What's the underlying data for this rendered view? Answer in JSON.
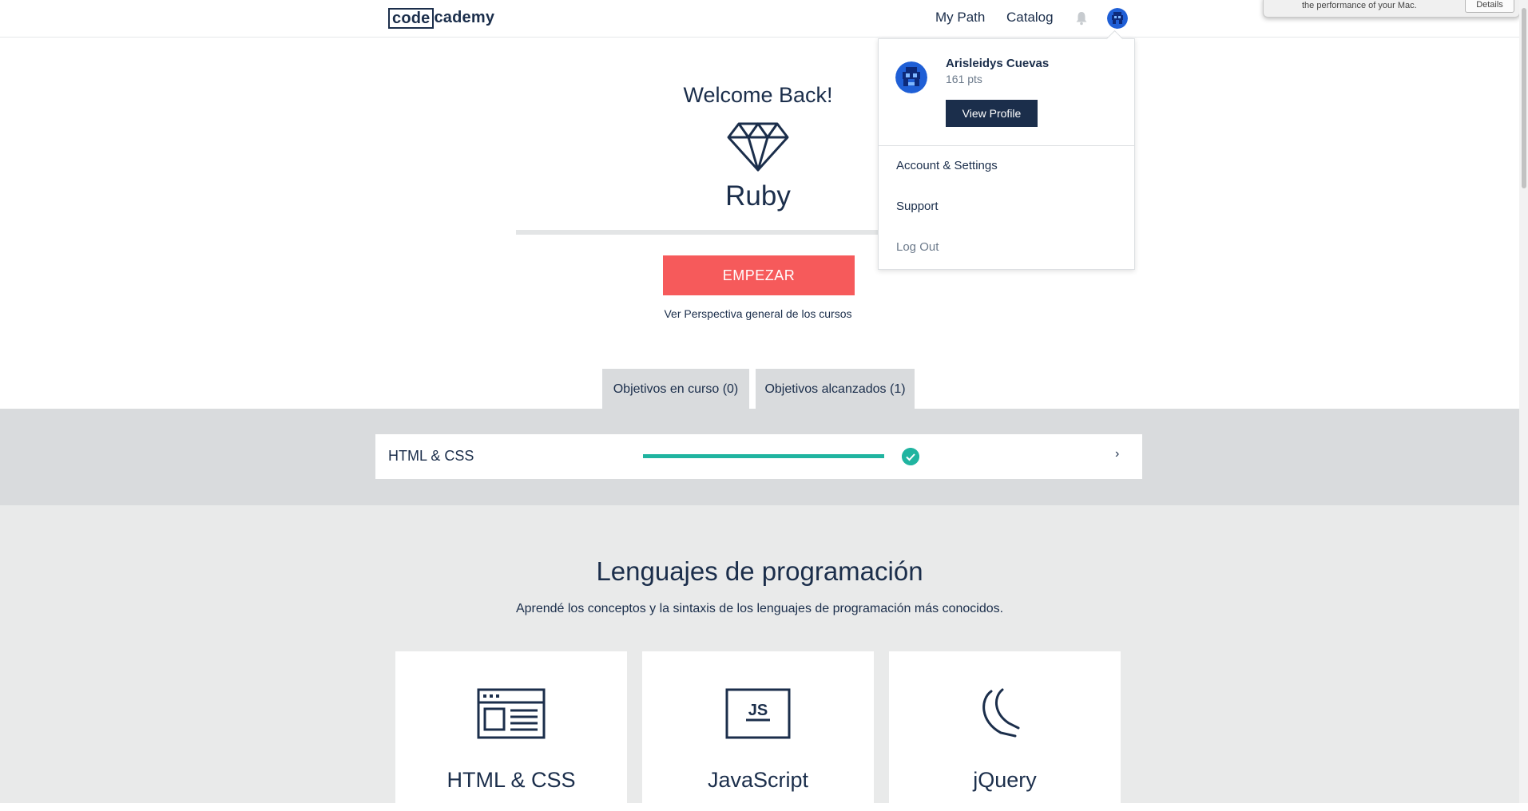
{
  "header": {
    "logo_left": "code",
    "logo_right": "cademy",
    "nav": [
      "My Path",
      "Catalog"
    ],
    "icons": [
      "bell-icon",
      "avatar-icon"
    ]
  },
  "mac_notification": {
    "text": "the performance of your Mac.",
    "button": "Details"
  },
  "hero": {
    "greeting": "Welcome Back!",
    "icon": "diamond-icon",
    "language": "Ruby",
    "cta": "EMPEZAR",
    "overview_link": "Ver Perspectiva general de los cursos"
  },
  "tabs": [
    {
      "label": "Objetivos en curso (0)"
    },
    {
      "label": "Objetivos alcanzados (1)"
    }
  ],
  "goals": [
    {
      "name": "HTML & CSS",
      "progress": 1.0,
      "status": "completed",
      "chevron": "›"
    }
  ],
  "languages_section": {
    "title": "Lenguajes de programación",
    "subtitle": "Aprendé los conceptos y la sintaxis de los lenguajes de programación más conocidos.",
    "cards": [
      {
        "name": "HTML & CSS",
        "icon": "browser-window-icon"
      },
      {
        "name": "JavaScript",
        "icon": "js-icon"
      },
      {
        "name": "jQuery",
        "icon": "jquery-icon"
      }
    ]
  },
  "user_menu": {
    "name": "Arisleidys Cuevas",
    "points": "161 pts",
    "view_profile": "View Profile",
    "items": [
      "Account & Settings",
      "Support",
      "Log Out"
    ]
  },
  "colors": {
    "navy": "#1b2e4b",
    "coral": "#f65a5b",
    "teal": "#20b4a0",
    "band_gray": "#d9dbdd",
    "section_gray": "#e9eaea"
  }
}
